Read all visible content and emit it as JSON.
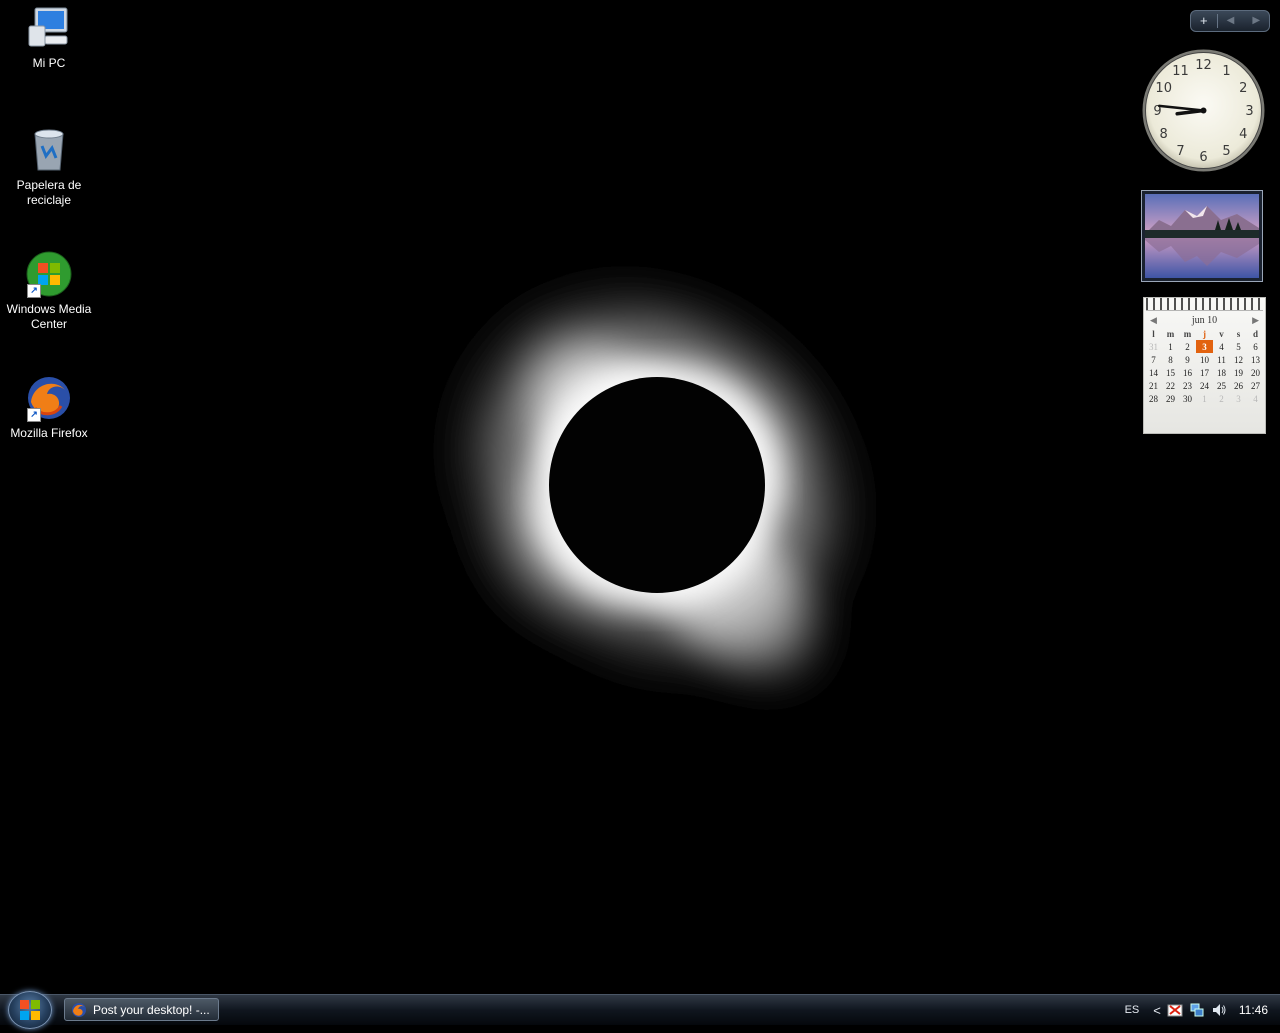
{
  "desktop": {
    "icons": [
      {
        "label": "Mi PC",
        "icon": "computer-icon"
      },
      {
        "label": "Papelera de reciclaje",
        "icon": "recycle-bin-icon"
      },
      {
        "label": "Windows Media Center",
        "icon": "windows-media-center-icon",
        "shortcut": true
      },
      {
        "label": "Mozilla Firefox",
        "icon": "firefox-icon",
        "shortcut": true
      }
    ]
  },
  "sidebar": {
    "controls": {
      "add": "+",
      "prev": "◀",
      "next": "▶"
    },
    "clock": {
      "hour": 8,
      "minute": 46
    },
    "slideshow": {
      "subject": "mountain lake landscape"
    },
    "calendar": {
      "month_label": "jun 10",
      "weekdays": [
        "l",
        "m",
        "m",
        "j",
        "v",
        "s",
        "d"
      ],
      "today_col": 3,
      "weeks": [
        [
          {
            "d": "31",
            "o": true
          },
          {
            "d": "1"
          },
          {
            "d": "2"
          },
          {
            "d": "3",
            "t": true
          },
          {
            "d": "4"
          },
          {
            "d": "5"
          },
          {
            "d": "6"
          }
        ],
        [
          {
            "d": "7"
          },
          {
            "d": "8"
          },
          {
            "d": "9"
          },
          {
            "d": "10"
          },
          {
            "d": "11"
          },
          {
            "d": "12"
          },
          {
            "d": "13"
          }
        ],
        [
          {
            "d": "14"
          },
          {
            "d": "15"
          },
          {
            "d": "16"
          },
          {
            "d": "17"
          },
          {
            "d": "18"
          },
          {
            "d": "19"
          },
          {
            "d": "20"
          }
        ],
        [
          {
            "d": "21"
          },
          {
            "d": "22"
          },
          {
            "d": "23"
          },
          {
            "d": "24"
          },
          {
            "d": "25"
          },
          {
            "d": "26"
          },
          {
            "d": "27"
          }
        ],
        [
          {
            "d": "28"
          },
          {
            "d": "29"
          },
          {
            "d": "30"
          },
          {
            "d": "1",
            "o": true
          },
          {
            "d": "2",
            "o": true
          },
          {
            "d": "3",
            "o": true
          },
          {
            "d": "4",
            "o": true
          }
        ]
      ]
    }
  },
  "taskbar": {
    "tasks": [
      {
        "label": "Post your desktop! -...",
        "icon": "firefox-icon"
      }
    ],
    "tray": {
      "language": "ES",
      "expand": "<",
      "time": "11:46"
    }
  },
  "colors": {
    "accent_today": "#e2620f",
    "taskbar": "#10161f"
  }
}
